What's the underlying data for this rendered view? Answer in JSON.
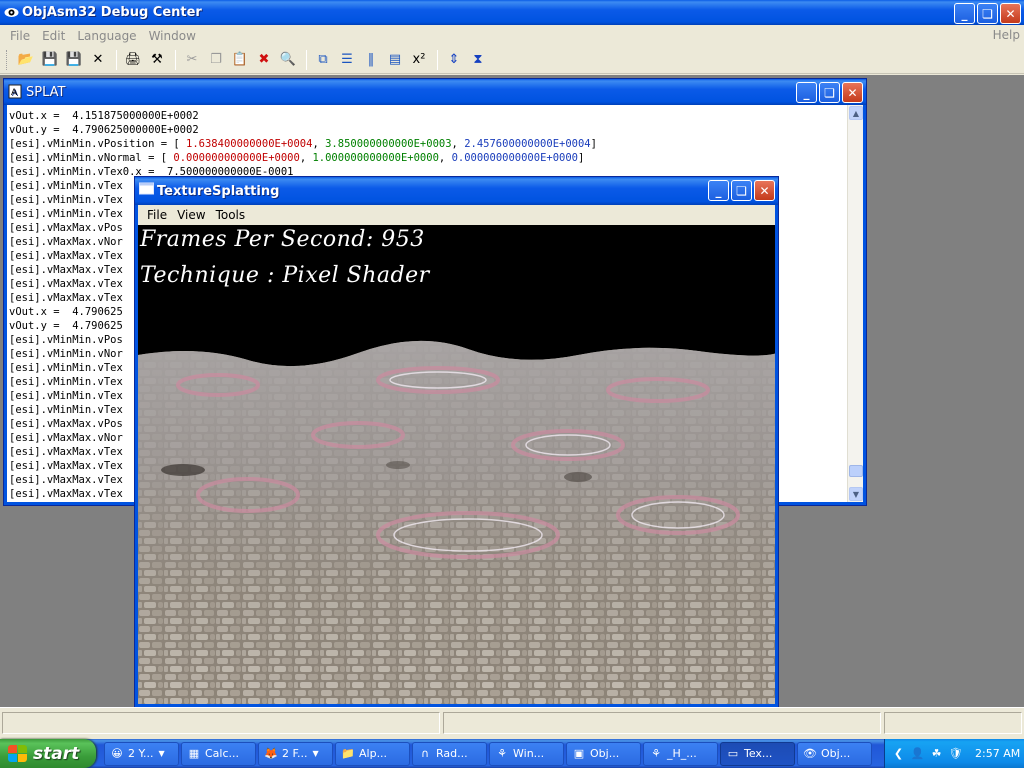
{
  "app": {
    "title": "ObjAsm32 Debug Center",
    "menus": [
      "File",
      "Edit",
      "Language",
      "Window"
    ],
    "help_menu": "Help",
    "window_buttons": [
      "_",
      "❏",
      "✕"
    ]
  },
  "toolbar": {
    "buttons": [
      {
        "name": "open-icon",
        "glyph": "📂"
      },
      {
        "name": "save-icon",
        "glyph": "💾"
      },
      {
        "name": "save-all-icon",
        "glyph": "💾"
      },
      {
        "name": "close-x-icon",
        "glyph": "✕"
      },
      {
        "name": "print-icon",
        "glyph": "🖨"
      },
      {
        "name": "settings-icon",
        "glyph": "⚒"
      },
      {
        "name": "cut-icon",
        "glyph": "✂"
      },
      {
        "name": "copy-icon",
        "glyph": "❐"
      },
      {
        "name": "paste-icon",
        "glyph": "📋"
      },
      {
        "name": "delete-icon",
        "glyph": "✖"
      },
      {
        "name": "find-icon",
        "glyph": "🔍"
      },
      {
        "name": "cascade-icon",
        "glyph": "⧉"
      },
      {
        "name": "tile-horizontal-icon",
        "glyph": "☰"
      },
      {
        "name": "tile-vertical-icon",
        "glyph": "‖"
      },
      {
        "name": "arrange-icon",
        "glyph": "▤"
      },
      {
        "name": "close-all-icon",
        "glyph": "x²"
      },
      {
        "name": "scroll-updown-icon",
        "glyph": "⇕"
      },
      {
        "name": "goto-end-icon",
        "glyph": "⧗"
      }
    ]
  },
  "splat": {
    "title": "SPLAT",
    "lines": [
      [
        "vOut.x =  4.151875000000E+0002"
      ],
      [
        "vOut.y =  4.790625000000E+0002"
      ],
      [
        "[esi].vMinMin.vPosition = [ ",
        {
          "r": "1.638400000000E+0004"
        },
        ", ",
        {
          "g": "3.850000000000E+0003"
        },
        ", ",
        {
          "b": "2.457600000000E+0004"
        },
        "]"
      ],
      [
        "[esi].vMinMin.vNormal = [ ",
        {
          "r": "0.000000000000E+0000"
        },
        ", ",
        {
          "g": "1.000000000000E+0000"
        },
        ", ",
        {
          "b": "0.000000000000E+0000"
        },
        "]"
      ],
      [
        "[esi].vMinMin.vTex0.x =  7.500000000000E-0001"
      ],
      [
        "[esi].vMinMin.vTex"
      ],
      [
        "[esi].vMinMin.vTex"
      ],
      [
        "[esi].vMinMin.vTex"
      ],
      [
        "[esi].vMaxMax.vPos"
      ],
      [
        "[esi].vMaxMax.vNor"
      ],
      [
        "[esi].vMaxMax.vTex"
      ],
      [
        "[esi].vMaxMax.vTex"
      ],
      [
        "[esi].vMaxMax.vTex"
      ],
      [
        "[esi].vMaxMax.vTex"
      ],
      [
        "vOut.x =  4.790625"
      ],
      [
        "vOut.y =  4.790625"
      ],
      [
        "[esi].vMinMin.vPos"
      ],
      [
        "[esi].vMinMin.vNor"
      ],
      [
        "[esi].vMinMin.vTex"
      ],
      [
        "[esi].vMinMin.vTex"
      ],
      [
        "[esi].vMinMin.vTex"
      ],
      [
        "[esi].vMinMin.vTex"
      ],
      [
        "[esi].vMaxMax.vPos"
      ],
      [
        "[esi].vMaxMax.vNor"
      ],
      [
        "[esi].vMaxMax.vTex"
      ],
      [
        "[esi].vMaxMax.vTex"
      ],
      [
        "[esi].vMaxMax.vTex"
      ],
      [
        "[esi].vMaxMax.vTex"
      ]
    ]
  },
  "texture_window": {
    "title": "TextureSplatting",
    "menus": [
      "File",
      "View",
      "Tools"
    ],
    "fps_line": "Frames Per Second: 953",
    "technique_line": "Technique : Pixel Shader"
  },
  "taskbar": {
    "start_label": "start",
    "tasks": [
      {
        "label": "2 Y...",
        "icon": "😀",
        "dropdown": true
      },
      {
        "label": "Calc...",
        "icon": "▦",
        "dropdown": false
      },
      {
        "label": "2 F...",
        "icon": "🦊",
        "dropdown": true
      },
      {
        "label": "Alp...",
        "icon": "📁",
        "dropdown": false
      },
      {
        "label": "Rad...",
        "icon": "∩",
        "dropdown": false
      },
      {
        "label": "Win...",
        "icon": "⚘",
        "dropdown": false
      },
      {
        "label": "Obj...",
        "icon": "▣",
        "dropdown": false
      },
      {
        "label": "_H_...",
        "icon": "⚘",
        "dropdown": false
      },
      {
        "label": "Tex...",
        "icon": "▭",
        "dropdown": false,
        "active": true
      },
      {
        "label": "Obj...",
        "icon": "👁",
        "dropdown": false
      }
    ],
    "tray_icons": [
      "❮",
      "👤",
      "☘",
      "🛡"
    ],
    "clock": "2:57 AM"
  }
}
